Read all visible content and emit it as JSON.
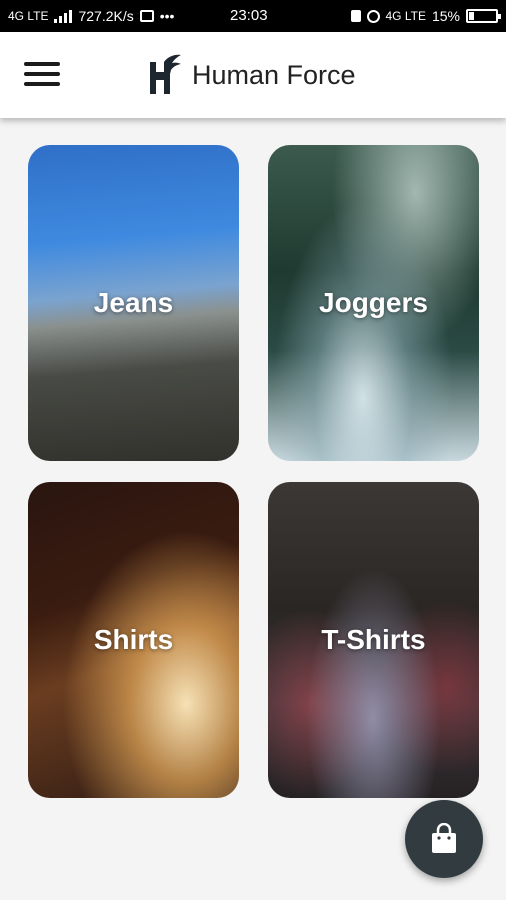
{
  "status_bar": {
    "network_left": "4G LTE",
    "speed": "727.2K/s",
    "dots": "•••",
    "time": "23:03",
    "network_right": "4G LTE",
    "battery": "15%"
  },
  "app_bar": {
    "title": "Human Force",
    "menu_icon": "hamburger-icon",
    "logo_icon": "winged-logo-icon"
  },
  "categories": [
    {
      "label": "Jeans"
    },
    {
      "label": "Joggers"
    },
    {
      "label": "Shirts"
    },
    {
      "label": "T-Shirts"
    }
  ],
  "fab": {
    "icon": "shopping-bag-icon"
  }
}
